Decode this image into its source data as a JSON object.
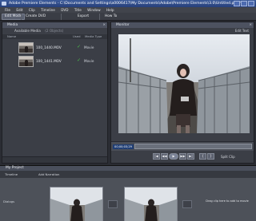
{
  "window": {
    "title": "Adobe Premiere Elements - C:\\Documents and Settings\\a0006417\\My Documents\\Adobe\\Premiere Elements\\3.0\\Untitled.prel *"
  },
  "menu": [
    "File",
    "Edit",
    "Clip",
    "Timeline",
    "DVD",
    "Title",
    "Window",
    "Help"
  ],
  "toolbar": {
    "edit_label": "Edit Mode",
    "create_dvd_label": "Create DVD",
    "export_label": "Export",
    "how_to_label": "How To"
  },
  "media": {
    "panel_title": "Media",
    "available_label": "Available Media",
    "count_label": "(2 Objects)",
    "columns": {
      "name": "Name",
      "used": "Used",
      "media_type": "Media Type"
    },
    "items": [
      {
        "name": "100_1440.MOV",
        "type": "Movie"
      },
      {
        "name": "100_1441.MOV",
        "type": "Movie"
      }
    ]
  },
  "monitor": {
    "panel_title": "Monitor",
    "edit_title_label": "Edit Text",
    "timecode": "00;00;03;29",
    "split_clip_label": "Split Clip"
  },
  "project": {
    "panel_title": "My Project",
    "timeline_button": "Timeline",
    "add_narration_button": "Add Narration",
    "storyboard_label": "Dialogs",
    "dropzone_text": "Drag clip here to add to movie"
  },
  "colors": {
    "title_bar": "#2e4a8a",
    "panel_bg": "#3b3e46",
    "accent_check": "#4ac04a",
    "timecode_bg": "#203e74"
  }
}
